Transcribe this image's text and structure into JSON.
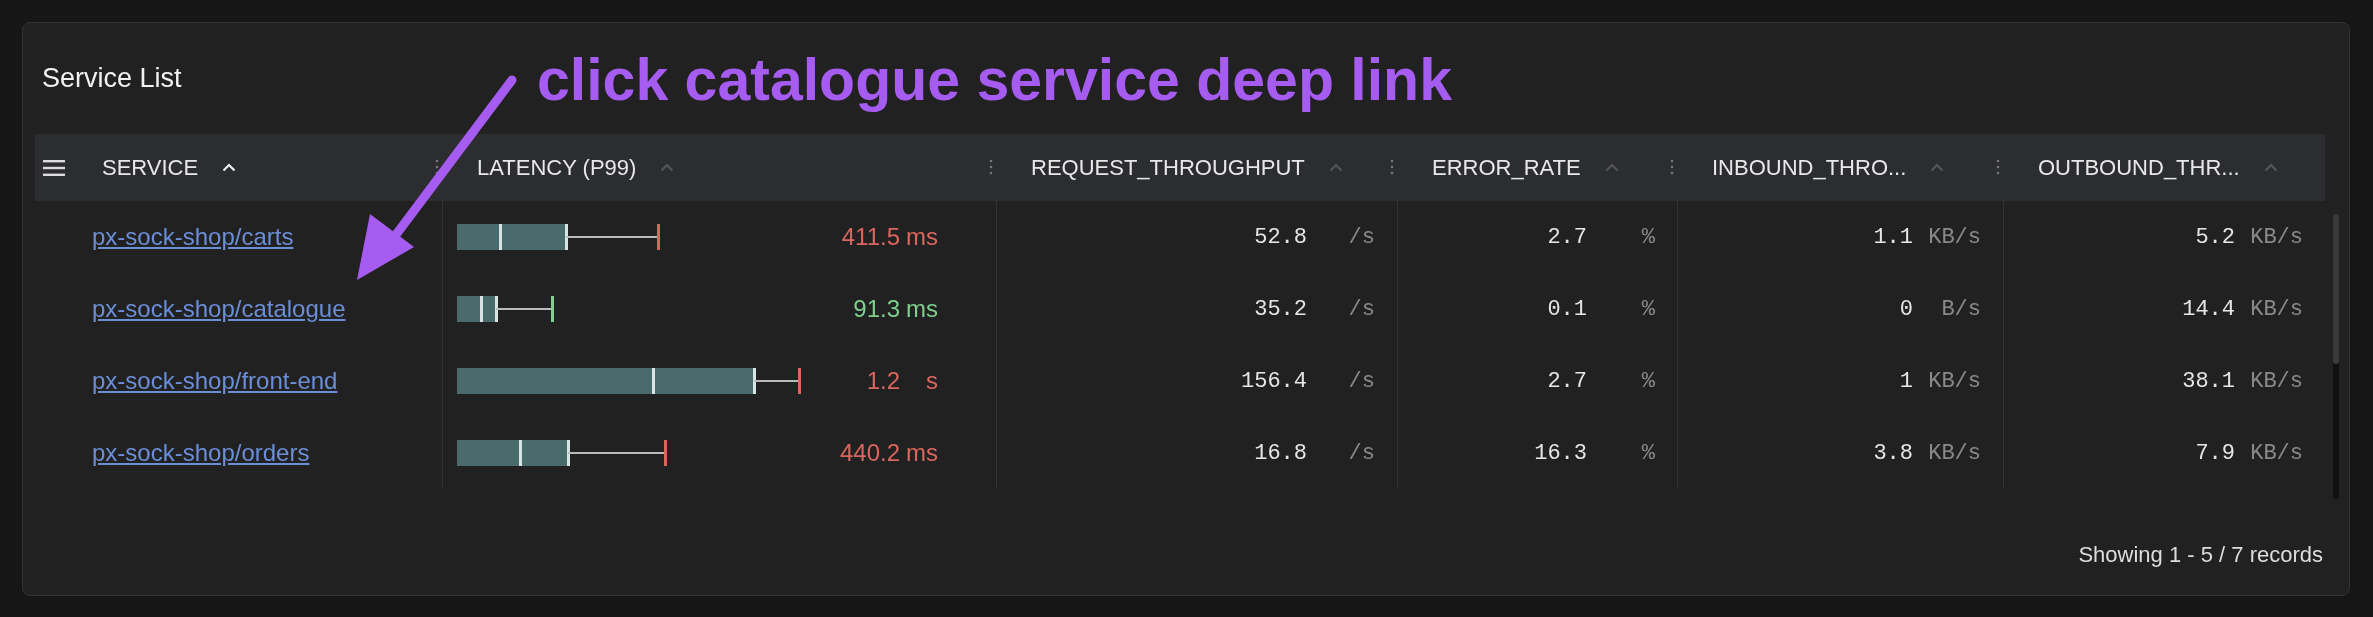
{
  "panel": {
    "title": "Service List"
  },
  "annotation": {
    "text": "click catalogue service deep link"
  },
  "table": {
    "columns": [
      {
        "label": "SERVICE",
        "sorted": true
      },
      {
        "label": "LATENCY (P99)",
        "sorted": false
      },
      {
        "label": "REQUEST_THROUGHPUT",
        "sorted": false
      },
      {
        "label": "ERROR_RATE",
        "sorted": false
      },
      {
        "label": "INBOUND_THRO...",
        "sorted": false
      },
      {
        "label": "OUTBOUND_THR...",
        "sorted": false
      }
    ],
    "rows": [
      {
        "service": "px-sock-shop/carts",
        "latency": {
          "value": "411.5",
          "unit": "ms",
          "color": "#d9675e"
        },
        "request_throughput": {
          "value": "52.8",
          "unit": "/s"
        },
        "error_rate": {
          "value": "2.7",
          "unit": "%"
        },
        "inbound": {
          "value": "1.1",
          "unit": "KB/s"
        },
        "outbound": {
          "value": "5.2",
          "unit": "KB/s"
        }
      },
      {
        "service": "px-sock-shop/catalogue",
        "latency": {
          "value": "91.3",
          "unit": "ms",
          "color": "#7fcf8e"
        },
        "request_throughput": {
          "value": "35.2",
          "unit": "/s"
        },
        "error_rate": {
          "value": "0.1",
          "unit": "%"
        },
        "inbound": {
          "value": "0",
          "unit": "B/s"
        },
        "outbound": {
          "value": "14.4",
          "unit": "KB/s"
        }
      },
      {
        "service": "px-sock-shop/front-end",
        "latency": {
          "value": "1.2",
          "unit": "s",
          "color": "#d9675e"
        },
        "request_throughput": {
          "value": "156.4",
          "unit": "/s"
        },
        "error_rate": {
          "value": "2.7",
          "unit": "%"
        },
        "inbound": {
          "value": "1",
          "unit": "KB/s"
        },
        "outbound": {
          "value": "38.1",
          "unit": "KB/s"
        }
      },
      {
        "service": "px-sock-shop/orders",
        "latency": {
          "value": "440.2",
          "unit": "ms",
          "color": "#d9675e"
        },
        "request_throughput": {
          "value": "16.8",
          "unit": "/s"
        },
        "error_rate": {
          "value": "16.3",
          "unit": "%"
        },
        "inbound": {
          "value": "3.8",
          "unit": "KB/s"
        },
        "outbound": {
          "value": "7.9",
          "unit": "KB/s"
        }
      }
    ]
  },
  "footer": {
    "text": "Showing 1 - 5 / 7 records"
  }
}
